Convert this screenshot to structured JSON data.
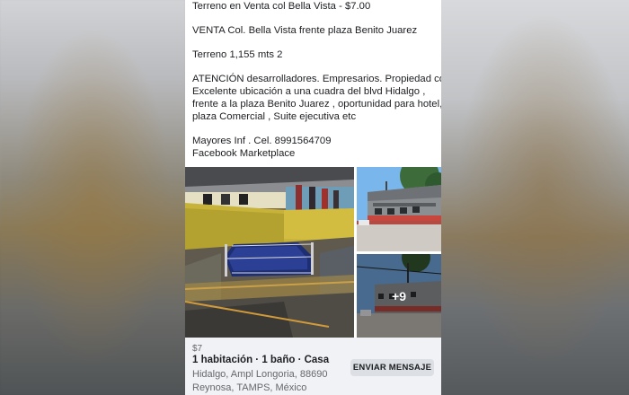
{
  "post": {
    "lines": [
      "Terreno en Venta col Bella Vista - $7.00",
      "VENTA Col. Bella Vista frente plaza Benito Juarez",
      "Terreno 1,155 mts 2",
      "ATENCIÓN desarrolladores. Empresarios. Propiedad con",
      "Excelente ubicación a una cuadra del blvd Hidalgo ,",
      " frente a la plaza Benito Juarez ,  oportunidad para hotel,",
      "plaza  Comercial , Suite ejecutiva etc",
      "Mayores Inf . Cel. 8991564709",
      "Facebook Marketplace"
    ]
  },
  "photos": {
    "main_alt": "boxing arena interior",
    "top_alt": "building exterior",
    "bottom_alt": "street view",
    "more_count": "+9"
  },
  "listing": {
    "price": "$7",
    "title": "1 habitación · 1 baño · Casa",
    "address_line1": "Hidalgo, Ampl Longoria, 88690",
    "address_line2": "Reynosa, TAMPS, México",
    "message_button": "ENVIAR MENSAJE"
  },
  "colors": {
    "text": "#1c1e21",
    "secondary_text": "#65676b",
    "card_bg": "#f0f2f5",
    "button_bg": "#dcdfe3"
  }
}
